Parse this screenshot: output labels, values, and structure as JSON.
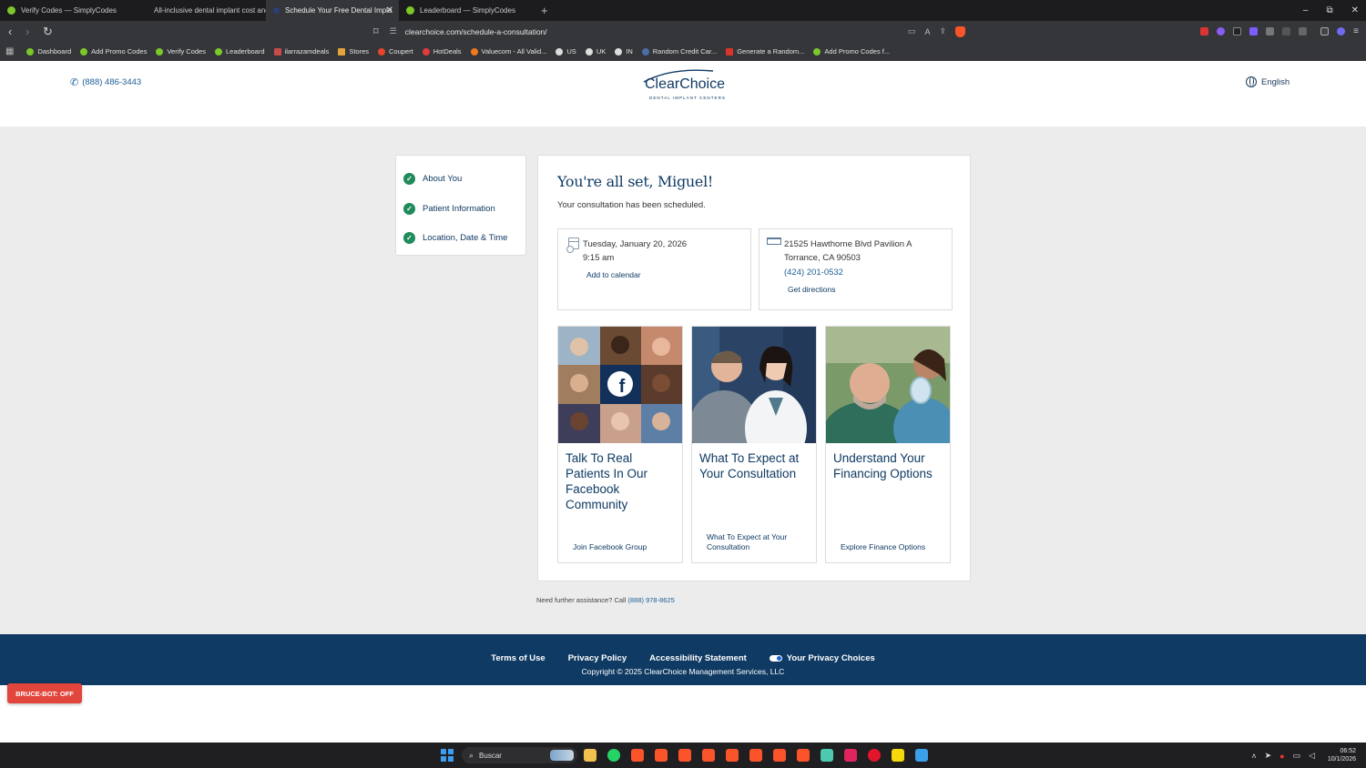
{
  "browser": {
    "tabs": [
      {
        "title": "Verify Codes — SimplyCodes",
        "active": false
      },
      {
        "title": "All-inclusive dental implant cost and",
        "active": false
      },
      {
        "title": "Schedule Your Free Dental Impla",
        "active": true
      },
      {
        "title": "Leaderboard — SimplyCodes",
        "active": false
      }
    ],
    "new_tab": "+",
    "window_controls": [
      "–",
      "⧉",
      "✕"
    ],
    "url": "clearchoice.com/schedule-a-consultation/",
    "bookmarks": [
      "Dashboard",
      "Add Promo Codes",
      "Verify Codes",
      "Leaderboard",
      "ilarrazamdeals",
      "Stores",
      "Coupert",
      "HotDeals",
      "Valuecom - All Valid...",
      "US",
      "UK",
      "IN",
      "Random Credit Car...",
      "Generate a Random...",
      "Add Promo Codes f..."
    ]
  },
  "header": {
    "phone": "(888) 486-3443",
    "logo_text": "ClearChoice",
    "logo_sub": "DENTAL IMPLANT CENTERS",
    "language": "English"
  },
  "steps": [
    {
      "label": "About You"
    },
    {
      "label": "Patient Information"
    },
    {
      "label": "Location, Date & Time"
    }
  ],
  "confirmation": {
    "title": "You're all set, Miguel!",
    "subtitle": "Your consultation has been scheduled.",
    "appointment": {
      "date": "Tuesday, January 20, 2026",
      "time": "9:15 am",
      "calendar_link": "Add to calendar"
    },
    "location": {
      "address1": "21525 Hawthorne Blvd Pavilion A",
      "address2": "Torrance, CA 90503",
      "phone": "(424) 201-0532",
      "directions_link": "Get directions"
    }
  },
  "tiles": [
    {
      "heading": "Talk To Real Patients In Our Facebook Community",
      "link": "Join Facebook Group"
    },
    {
      "heading": "What To Expect at Your Consultation",
      "link": "What To Expect at Your Consultation"
    },
    {
      "heading": "Understand Your Financing Options",
      "link": "Explore Finance Options"
    }
  ],
  "help": {
    "text": "Need further assistance? Call",
    "phone": "(888) 978-8625"
  },
  "footer": {
    "links": [
      "Terms of Use",
      "Privacy Policy",
      "Accessibility Statement",
      "Your Privacy Choices"
    ],
    "copyright": "Copyright © 2025 ClearChoice Management Services, LLC"
  },
  "bruce_bot": "BRUCE-BOT: OFF",
  "taskbar": {
    "search_placeholder": "Buscar",
    "time": "06:52",
    "date": "10/1/2026"
  },
  "colors": {
    "brand_navy": "#0f3a63",
    "check_green": "#1f8a5a",
    "link_blue": "#1d5f97",
    "bruce_red": "#e2453c"
  }
}
